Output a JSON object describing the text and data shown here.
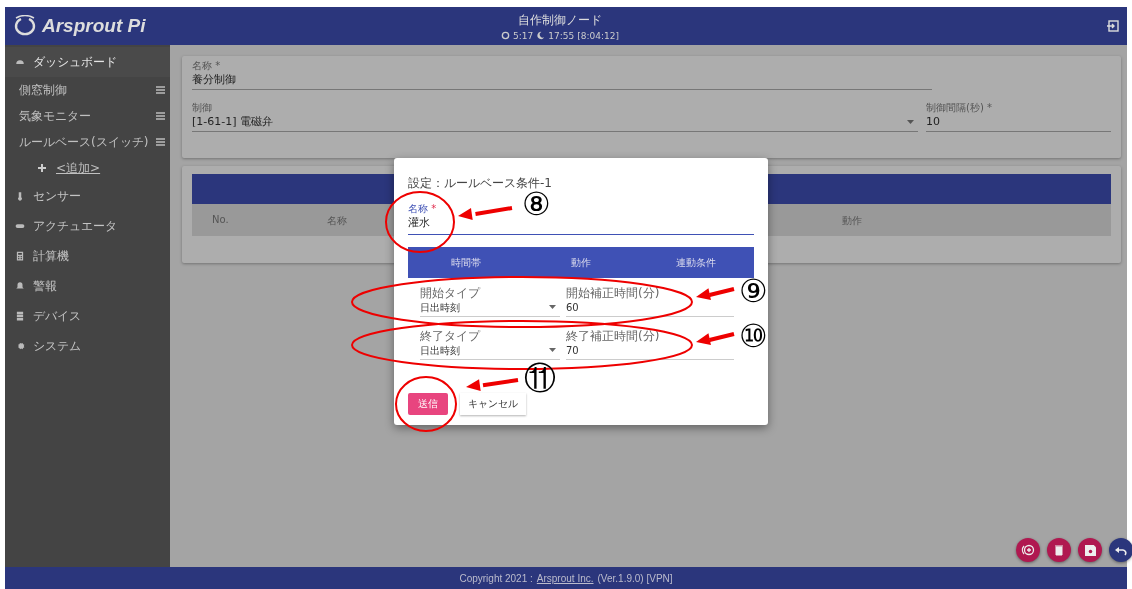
{
  "header": {
    "logo": "Arsprout Pi",
    "title": "自作制御ノード",
    "sunrise": "5:17",
    "sunset": "17:55",
    "day_length": "[8:04:12]"
  },
  "sidebar": {
    "items": [
      {
        "label": "ダッシュボード",
        "expanded": true,
        "children": [
          {
            "label": "側窓制御",
            "kind": "page"
          },
          {
            "label": "気象モニター",
            "kind": "page"
          },
          {
            "label": "ルールベース(スイッチ)",
            "kind": "page"
          },
          {
            "label": "<追加>",
            "kind": "add"
          }
        ]
      },
      {
        "label": "センサー"
      },
      {
        "label": "アクチュエータ"
      },
      {
        "label": "計算機"
      },
      {
        "label": "警報"
      },
      {
        "label": "デバイス"
      },
      {
        "label": "システム"
      }
    ]
  },
  "form": {
    "name": {
      "label": "名称 *",
      "value": "養分制御"
    },
    "control": {
      "label": "制御",
      "value": "[1-61-1] 電磁弁"
    },
    "interval": {
      "label": "制御間隔(秒) *",
      "value": "10"
    }
  },
  "table": {
    "columns": [
      "No.",
      "名称",
      "動作"
    ]
  },
  "dialog": {
    "title": "設定：ルールベース条件-1",
    "name": {
      "label": "名称",
      "required_mark": "*",
      "value": "灌水"
    },
    "columns": [
      "時間帯",
      "動作",
      "連動条件"
    ],
    "rows": [
      {
        "select_label": "開始タイプ",
        "select_value": "日出時刻",
        "offset_label": "開始補正時間(分)",
        "offset_value": "60"
      },
      {
        "select_label": "終了タイプ",
        "select_value": "日出時刻",
        "offset_label": "終了補正時間(分)",
        "offset_value": "70"
      }
    ],
    "submit": "送信",
    "cancel": "キャンセル"
  },
  "annotations": [
    "⑧",
    "⑨",
    "⑩",
    "⑪"
  ],
  "footer": {
    "text": "Copyright 2021 :",
    "link": "Arsprout Inc.",
    "version": "(Ver.1.9.0) [VPN]"
  }
}
